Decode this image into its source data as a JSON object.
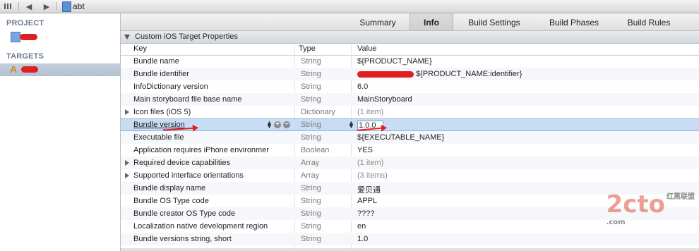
{
  "topbar": {
    "breadcrumb": "abt"
  },
  "sidebar": {
    "project_heading": "PROJECT",
    "targets_heading": "TARGETS"
  },
  "tabs": [
    {
      "label": "Summary"
    },
    {
      "label": "Info"
    },
    {
      "label": "Build Settings"
    },
    {
      "label": "Build Phases"
    },
    {
      "label": "Build Rules"
    }
  ],
  "section": {
    "title": "Custom iOS Target Properties"
  },
  "columns": {
    "key": "Key",
    "type": "Type",
    "value": "Value"
  },
  "rows": [
    {
      "key": "Bundle name",
      "type": "String",
      "value": "${PRODUCT_NAME}"
    },
    {
      "key": "Bundle identifier",
      "type": "String",
      "value": "${PRODUCT_NAME:identifier}"
    },
    {
      "key": "InfoDictionary version",
      "type": "String",
      "value": "6.0"
    },
    {
      "key": "Main storyboard file base name",
      "type": "String",
      "value": "MainStoryboard"
    },
    {
      "key": "Icon files (iOS 5)",
      "type": "Dictionary",
      "value": "(1 item)"
    },
    {
      "key": "Bundle version",
      "type": "String",
      "value": "1.0.0"
    },
    {
      "key": "Executable file",
      "type": "String",
      "value": "${EXECUTABLE_NAME}"
    },
    {
      "key": "Application requires iPhone environmer",
      "type": "Boolean",
      "value": "YES"
    },
    {
      "key": "Required device capabilities",
      "type": "Array",
      "value": "(1 item)"
    },
    {
      "key": "Supported interface orientations",
      "type": "Array",
      "value": "(3 items)"
    },
    {
      "key": "Bundle display name",
      "type": "String",
      "value": "爱贝通"
    },
    {
      "key": "Bundle OS Type code",
      "type": "String",
      "value": "APPL"
    },
    {
      "key": "Bundle creator OS Type code",
      "type": "String",
      "value": "????"
    },
    {
      "key": "Localization native development region",
      "type": "String",
      "value": "en"
    },
    {
      "key": "Bundle versions string, short",
      "type": "String",
      "value": "1.0"
    }
  ],
  "watermark": {
    "text": "2cto",
    "suffix": ".com",
    "cn": "红黑联盟"
  },
  "colors": {
    "selection": "#c9dcf5",
    "redaction": "#e0201f"
  }
}
